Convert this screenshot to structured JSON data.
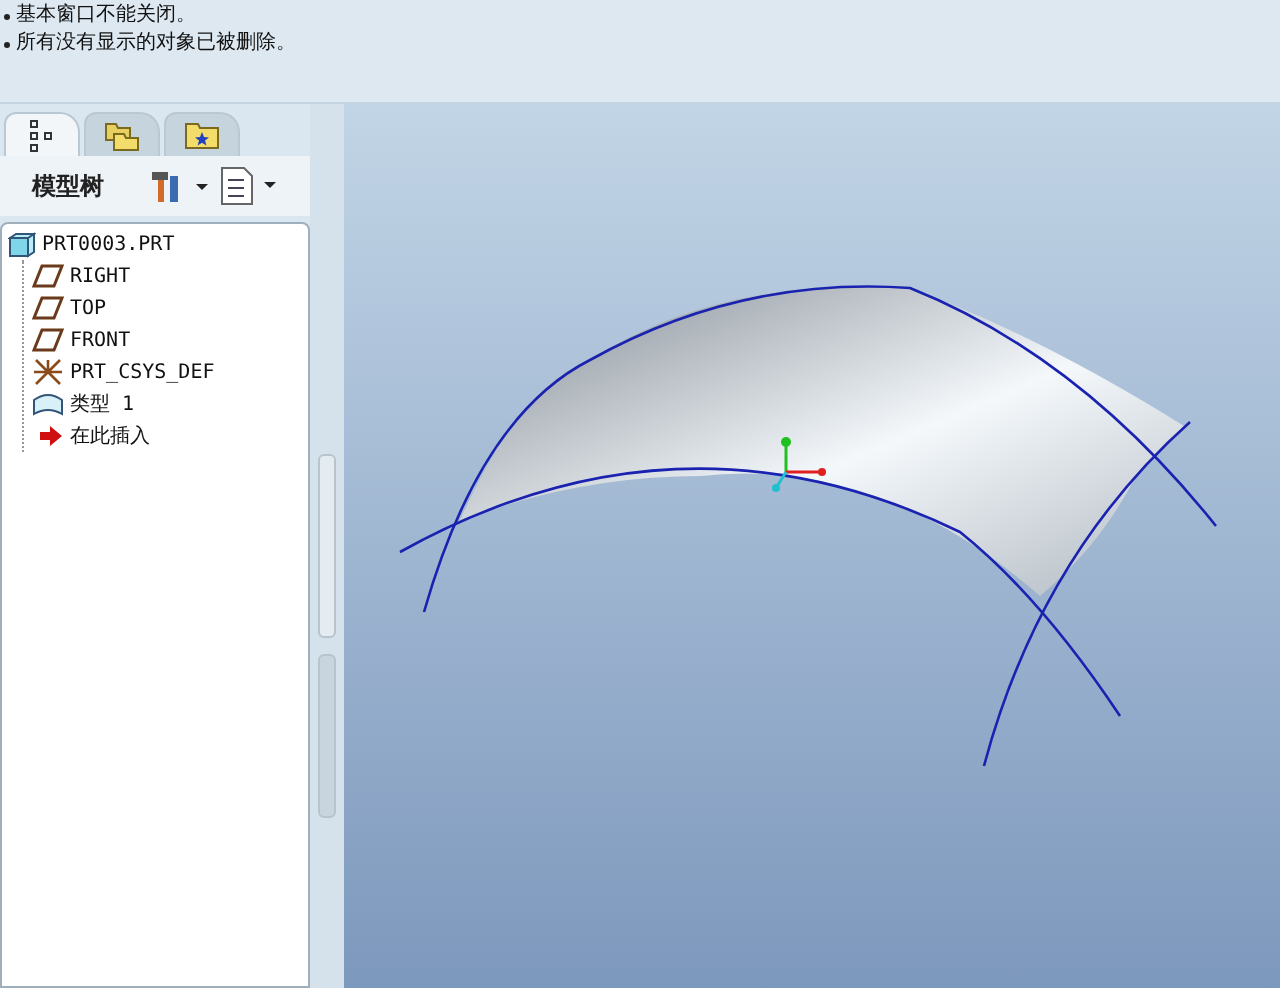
{
  "messages": [
    "基本窗口不能关闭。",
    "所有没有显示的对象已被删除。"
  ],
  "navigator_tabs": [
    {
      "kind": "tree",
      "selected": true
    },
    {
      "kind": "folders",
      "selected": false
    },
    {
      "kind": "favorites",
      "selected": false
    }
  ],
  "model_tree": {
    "title": "模型树",
    "items": [
      {
        "kind": "part",
        "label": "PRT0003.PRT",
        "children": [
          {
            "kind": "plane",
            "label": "RIGHT"
          },
          {
            "kind": "plane",
            "label": "TOP"
          },
          {
            "kind": "plane",
            "label": "FRONT"
          },
          {
            "kind": "csys",
            "label": "PRT_CSYS_DEF"
          },
          {
            "kind": "surface",
            "label": "类型 1"
          },
          {
            "kind": "insert",
            "label": "在此插入"
          }
        ]
      }
    ]
  }
}
